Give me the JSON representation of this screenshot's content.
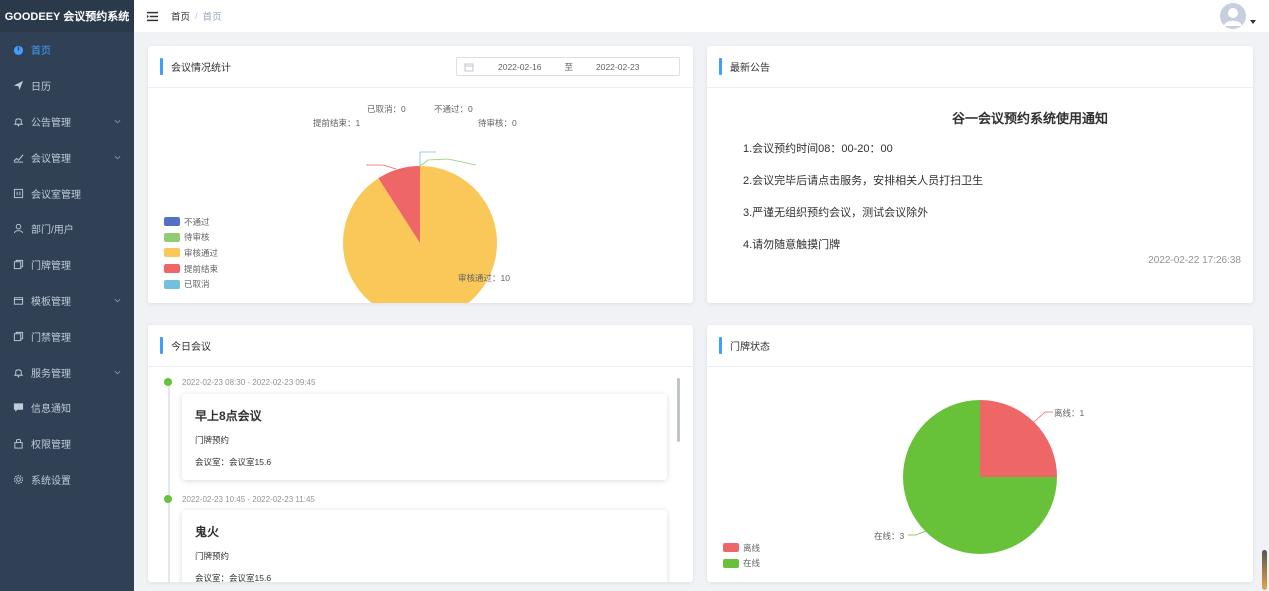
{
  "app": {
    "logo": "GOODEEY 会议预约系统"
  },
  "sidebar": {
    "items": [
      {
        "label": "首页",
        "icon": "dashboard-icon",
        "active": true,
        "has_arrow": false
      },
      {
        "label": "日历",
        "icon": "send-icon",
        "active": false,
        "has_arrow": false
      },
      {
        "label": "公告管理",
        "icon": "bell-icon",
        "active": false,
        "has_arrow": true
      },
      {
        "label": "会议管理",
        "icon": "edit-icon",
        "active": false,
        "has_arrow": true
      },
      {
        "label": "会议室管理",
        "icon": "room-icon",
        "active": false,
        "has_arrow": false
      },
      {
        "label": "部门/用户",
        "icon": "user-icon",
        "active": false,
        "has_arrow": false
      },
      {
        "label": "门牌管理",
        "icon": "copy-icon",
        "active": false,
        "has_arrow": false
      },
      {
        "label": "模板管理",
        "icon": "folder-icon",
        "active": false,
        "has_arrow": true
      },
      {
        "label": "门禁管理",
        "icon": "copy-icon",
        "active": false,
        "has_arrow": false
      },
      {
        "label": "服务管理",
        "icon": "bell-icon",
        "active": false,
        "has_arrow": true
      },
      {
        "label": "信息通知",
        "icon": "message-icon",
        "active": false,
        "has_arrow": false
      },
      {
        "label": "权限管理",
        "icon": "lock-icon",
        "active": false,
        "has_arrow": false
      },
      {
        "label": "系统设置",
        "icon": "gear-icon",
        "active": false,
        "has_arrow": false
      }
    ]
  },
  "header": {
    "breadcrumb": [
      "首页",
      "首页"
    ],
    "separator": "/"
  },
  "stats_card": {
    "title": "会议情况统计",
    "date_start": "2022-02-16",
    "date_sep": "至",
    "date_end": "2022-02-23",
    "legend": [
      {
        "name": "不通过",
        "color": "#5470c6"
      },
      {
        "name": "待审核",
        "color": "#91cc75"
      },
      {
        "name": "审核通过",
        "color": "#fac858"
      },
      {
        "name": "提前结束",
        "color": "#ee6666"
      },
      {
        "name": "已取消",
        "color": "#73c0de"
      }
    ],
    "labels": {
      "cancelled": "已取消：0",
      "rejected": "不通过：0",
      "early_end": "提前结束：1",
      "pending": "待审核：0",
      "approved": "审核通过：10"
    }
  },
  "notice_card": {
    "title": "最新公告",
    "notice_title": "谷一会议预约系统使用通知",
    "lines": [
      "1.会议预约时间08：00-20：00",
      "2.会议完毕后请点击服务，安排相关人员打扫卫生",
      "3.严谨无组织预约会议，测试会议除外",
      "4.请勿随意触摸门牌"
    ],
    "time": "2022-02-22 17:26:38"
  },
  "today_card": {
    "title": "今日会议",
    "meetings": [
      {
        "time": "2022-02-23 08:30 - 2022-02-23 09:45",
        "title": "早上8点会议",
        "sub": "门牌预约",
        "room": "会议室：会议室15.6"
      },
      {
        "time": "2022-02-23 10:45 - 2022-02-23 11:45",
        "title": "鬼火",
        "sub": "门牌预约",
        "room": "会议室：会议室15.6"
      }
    ]
  },
  "door_card": {
    "title": "门牌状态",
    "legend": [
      {
        "name": "离线",
        "color": "#ee6666"
      },
      {
        "name": "在线",
        "color": "#67c23a"
      }
    ],
    "labels": {
      "offline": "离线：1",
      "online": "在线：3"
    }
  },
  "chart_data": [
    {
      "type": "pie",
      "title": "会议情况统计",
      "categories": [
        "不通过",
        "待审核",
        "审核通过",
        "提前结束",
        "已取消"
      ],
      "values": [
        0,
        0,
        10,
        1,
        0
      ],
      "colors": [
        "#5470c6",
        "#91cc75",
        "#fac858",
        "#ee6666",
        "#73c0de"
      ],
      "legend": "bottom-left"
    },
    {
      "type": "pie",
      "title": "门牌状态",
      "categories": [
        "离线",
        "在线"
      ],
      "values": [
        1,
        3
      ],
      "colors": [
        "#ee6666",
        "#67c23a"
      ],
      "legend": "bottom-left"
    }
  ]
}
